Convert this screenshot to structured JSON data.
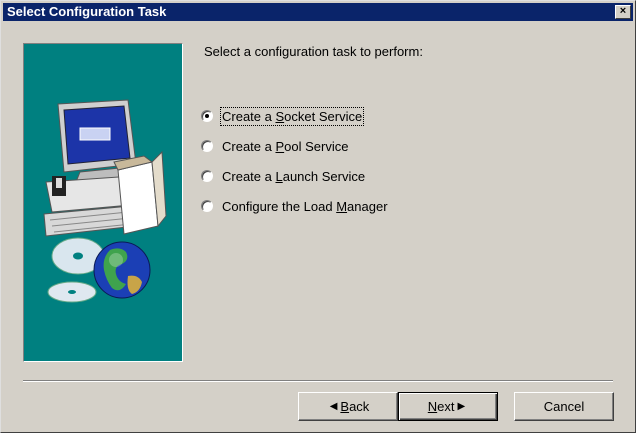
{
  "window": {
    "title": "Select Configuration Task",
    "close_glyph": "×"
  },
  "prompt": "Select a configuration task to perform:",
  "options": [
    {
      "pre": "Create a ",
      "key": "S",
      "post": "ocket Service",
      "selected": true
    },
    {
      "pre": "Create a ",
      "key": "P",
      "post": "ool Service",
      "selected": false
    },
    {
      "pre": "Create a ",
      "key": "L",
      "post": "aunch Service",
      "selected": false
    },
    {
      "pre": "Configure the Load ",
      "key": "M",
      "post": "anager",
      "selected": false
    }
  ],
  "buttons": {
    "back": {
      "arrow": "◀",
      "key": "B",
      "post": "ack"
    },
    "next": {
      "key": "N",
      "post": "ext",
      "arrow": "▶"
    },
    "cancel": {
      "label": "Cancel"
    }
  },
  "colors": {
    "title_bar": "#0a246a",
    "panel_bg": "#008080",
    "dialog_bg": "#d4d0c8"
  },
  "icons": [
    "computer-icon",
    "cd-discs-icon",
    "globe-icon",
    "close-icon"
  ]
}
